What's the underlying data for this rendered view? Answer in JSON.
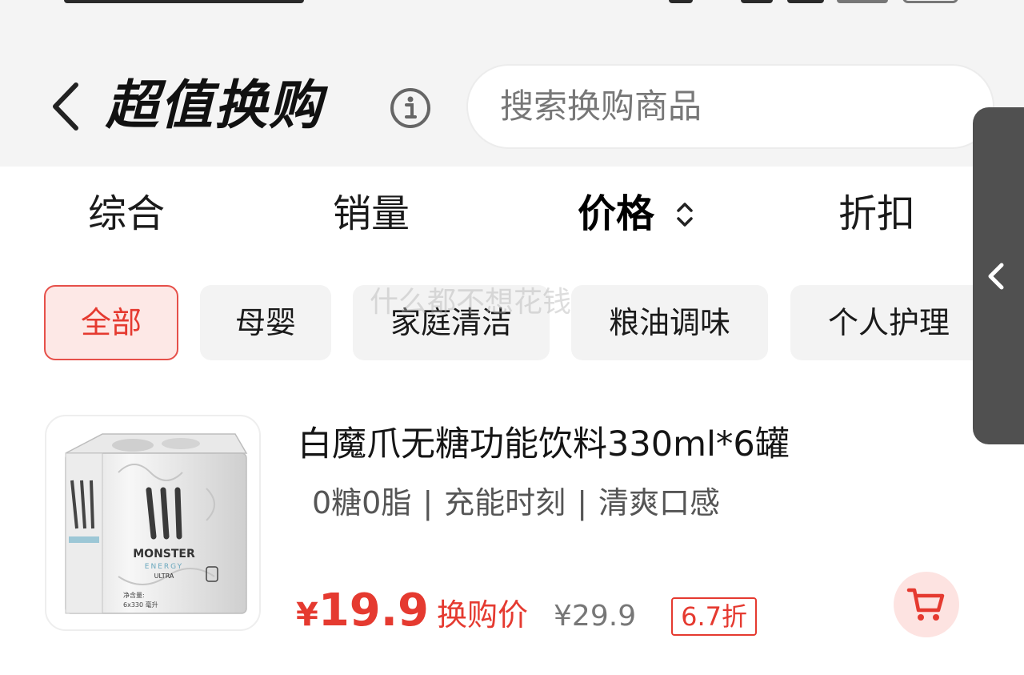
{
  "header": {
    "title": "超值换购",
    "search_placeholder": "搜索换购商品"
  },
  "sort_tabs": [
    {
      "label": "综合",
      "active": false
    },
    {
      "label": "销量",
      "active": false
    },
    {
      "label": "价格",
      "active": true
    },
    {
      "label": "折扣",
      "active": false
    }
  ],
  "categories": [
    {
      "label": "全部",
      "active": true
    },
    {
      "label": "母婴",
      "active": false
    },
    {
      "label": "家庭清洁",
      "active": false
    },
    {
      "label": "粮油调味",
      "active": false
    },
    {
      "label": "个人护理",
      "active": false
    }
  ],
  "watermark": "什么都不想花钱",
  "product": {
    "title": "白魔爪无糖功能饮料330ml*6罐",
    "tags": [
      "0糖0脂",
      "充能时刻",
      "清爽口感"
    ],
    "price_symbol": "¥",
    "price": "19.9",
    "price_label": "换购价",
    "original_price": "¥29.9",
    "discount": "6.7折",
    "image_text": {
      "brand": "MONSTER",
      "sub": "ENERGY",
      "variant": "ULTRA",
      "volume": "净含量:",
      "volume_value": "6x330 毫升"
    }
  },
  "colors": {
    "accent": "#e53a30",
    "chip_active_bg": "#fde8e6",
    "header_bg": "#f4f4f4",
    "side_panel": "#505050"
  },
  "icons": {
    "back": "chevron-left-icon",
    "info": "info-icon",
    "sort": "sort-arrows-icon",
    "side": "chevron-left-icon",
    "cart": "cart-icon"
  }
}
